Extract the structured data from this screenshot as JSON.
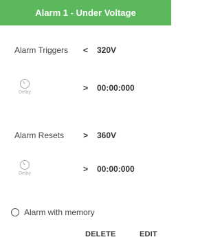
{
  "header": {
    "title": "Alarm 1 - Under Voltage",
    "bg_color": "#5cb85c"
  },
  "trigger": {
    "label": "Alarm Triggers",
    "operator": "<",
    "value": "320V"
  },
  "trigger_delay": {
    "icon": "timer-icon",
    "caption": "Delay",
    "operator": ">",
    "value": "00:00:000"
  },
  "reset": {
    "label": "Alarm Resets",
    "operator": ">",
    "value": "360V"
  },
  "reset_delay": {
    "icon": "timer-icon",
    "caption": "Delay",
    "operator": ">",
    "value": "00:00:000"
  },
  "memory": {
    "label": "Alarm with memory",
    "checked": false
  },
  "actions": {
    "delete_label": "DELETE",
    "edit_label": "EDIT"
  }
}
